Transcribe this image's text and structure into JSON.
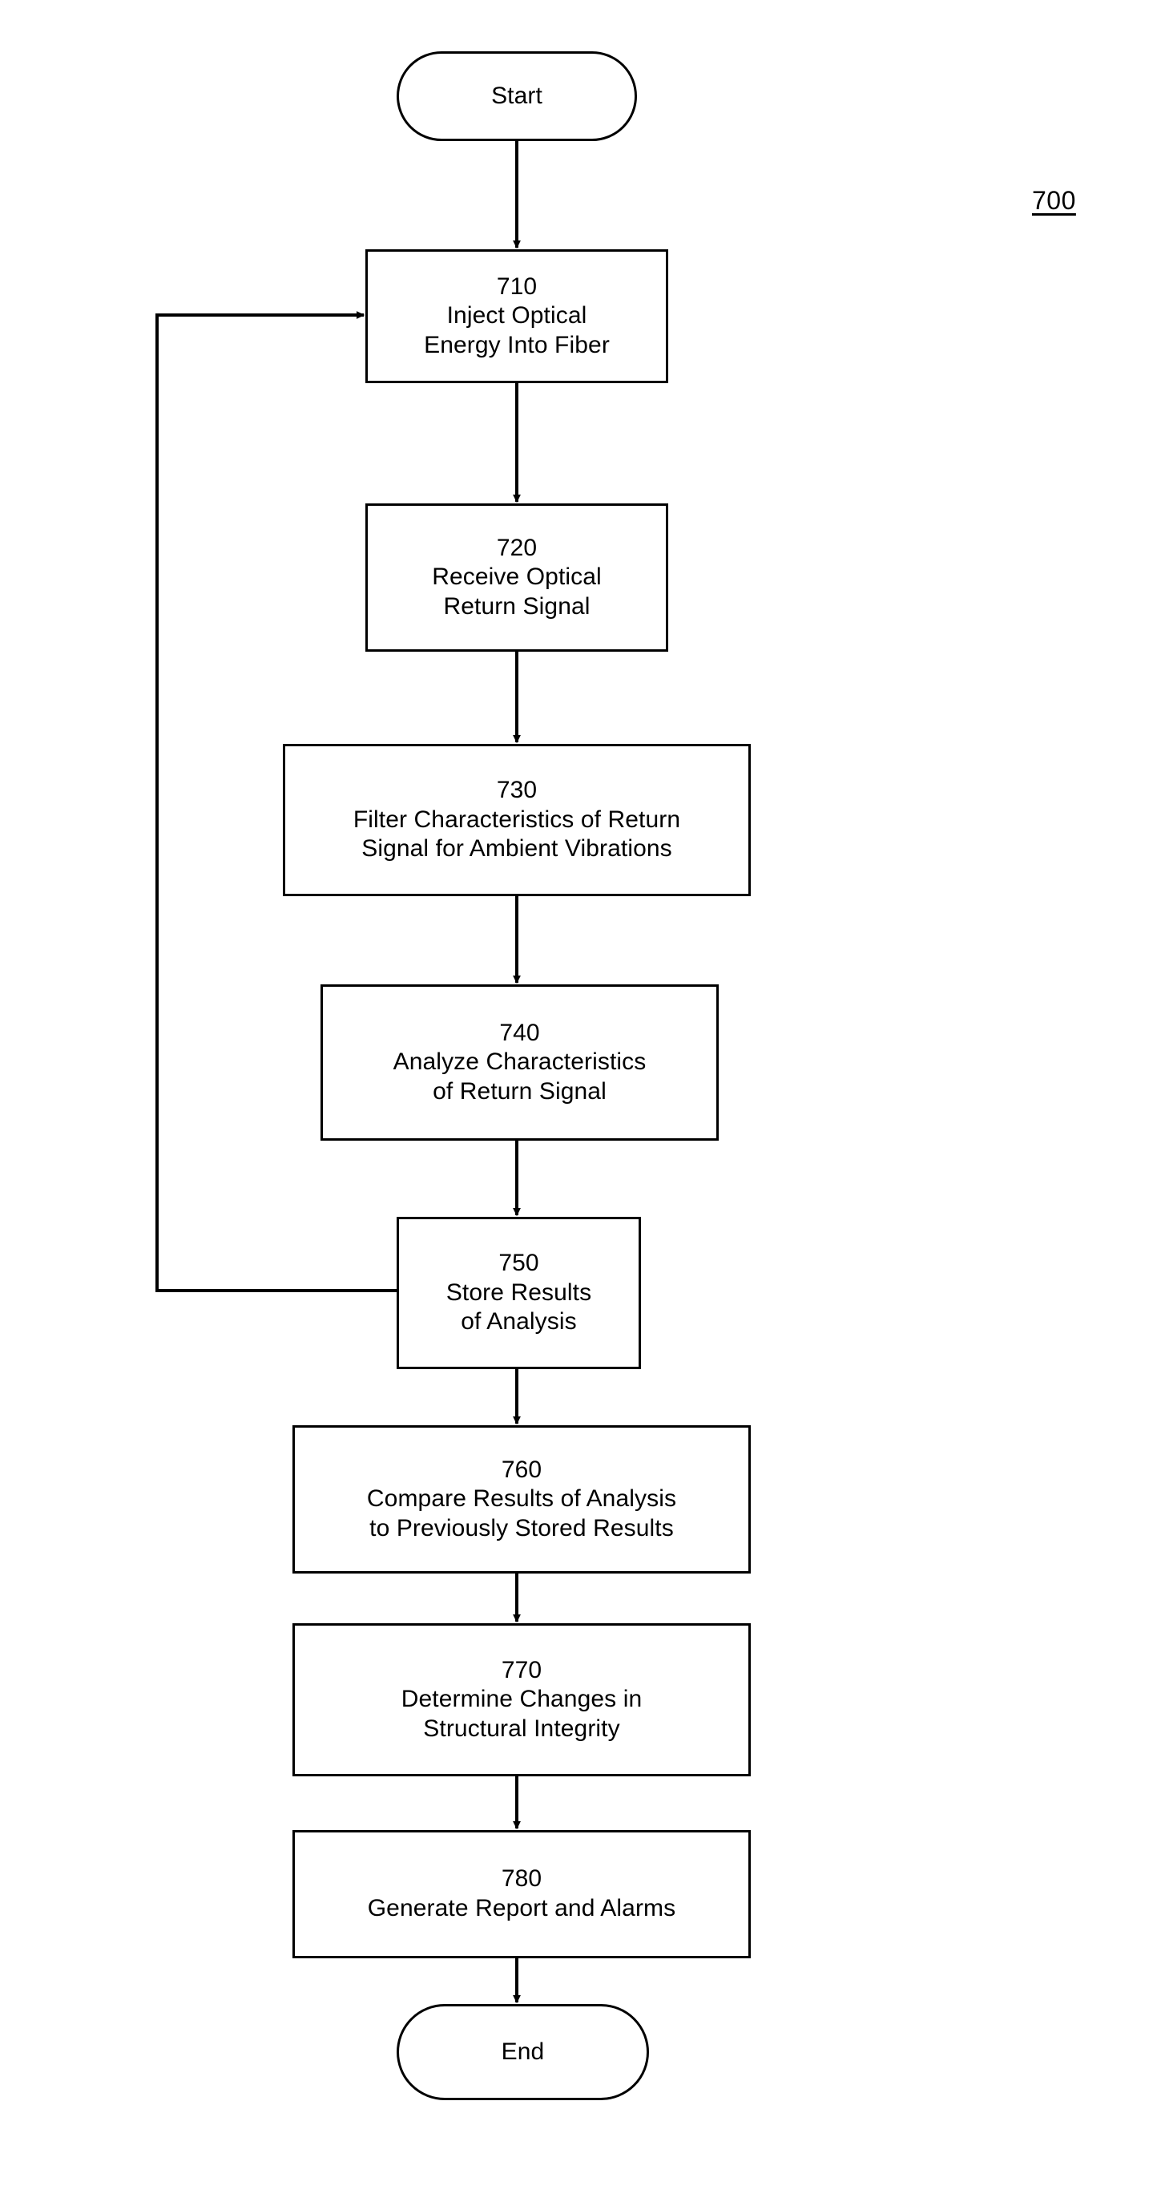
{
  "figure": {
    "label": "700"
  },
  "diagram": {
    "type": "flowchart",
    "orientation": "vertical",
    "title": "700",
    "nodes": [
      {
        "id": "start",
        "shape": "terminal",
        "ref": "",
        "text": "Start"
      },
      {
        "id": "step-710",
        "shape": "process",
        "ref": "710",
        "line1": "Inject Optical",
        "line2": "Energy Into Fiber"
      },
      {
        "id": "step-720",
        "shape": "process",
        "ref": "720",
        "line1": "Receive Optical",
        "line2": "Return Signal"
      },
      {
        "id": "step-730",
        "shape": "process",
        "ref": "730",
        "line1": "Filter Characteristics of Return",
        "line2": "Signal for Ambient Vibrations"
      },
      {
        "id": "step-740",
        "shape": "process",
        "ref": "740",
        "line1": "Analyze Characteristics",
        "line2": "of Return Signal"
      },
      {
        "id": "step-750",
        "shape": "process",
        "ref": "750",
        "line1": "Store Results",
        "line2": "of Analysis"
      },
      {
        "id": "step-760",
        "shape": "process",
        "ref": "760",
        "line1": "Compare Results of Analysis",
        "line2": "to Previously Stored Results"
      },
      {
        "id": "step-770",
        "shape": "process",
        "ref": "770",
        "line1": "Determine Changes in",
        "line2": "Structural Integrity"
      },
      {
        "id": "step-780",
        "shape": "process",
        "ref": "780",
        "line1": "Generate Report and Alarms",
        "line2": ""
      },
      {
        "id": "end",
        "shape": "terminal",
        "ref": "",
        "text": "End"
      }
    ],
    "edges": [
      {
        "from": "start",
        "to": "step-710",
        "kind": "arrow-down"
      },
      {
        "from": "step-710",
        "to": "step-720",
        "kind": "arrow-down"
      },
      {
        "from": "step-720",
        "to": "step-730",
        "kind": "arrow-down"
      },
      {
        "from": "step-730",
        "to": "step-740",
        "kind": "arrow-down"
      },
      {
        "from": "step-740",
        "to": "step-750",
        "kind": "arrow-down"
      },
      {
        "from": "step-750",
        "to": "step-760",
        "kind": "arrow-down"
      },
      {
        "from": "step-760",
        "to": "step-770",
        "kind": "arrow-down"
      },
      {
        "from": "step-770",
        "to": "step-780",
        "kind": "arrow-down"
      },
      {
        "from": "step-780",
        "to": "end",
        "kind": "arrow-down"
      },
      {
        "from": "step-750",
        "to": "step-710",
        "kind": "feedback-left"
      }
    ],
    "colors": {
      "background": "#ffffff",
      "stroke": "#000000",
      "text": "#000000"
    }
  }
}
